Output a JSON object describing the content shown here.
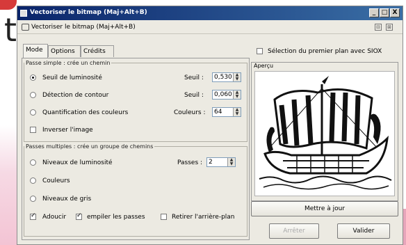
{
  "window": {
    "title": "Vectoriser le bitmap (Maj+Alt+B)",
    "controls": {
      "minimize": "_",
      "maximize": "□",
      "close": "X"
    }
  },
  "subheader": {
    "title": "Vectoriser le bitmap (Maj+Alt+B)",
    "btn1": "⊟",
    "btn2": "⊠"
  },
  "tabs": [
    {
      "label": "Mode"
    },
    {
      "label": "Options"
    },
    {
      "label": "Crédits"
    }
  ],
  "single_scan": {
    "legend": "Passe simple : crée un chemin",
    "brightness": {
      "label": "Seuil de luminosité",
      "param_label": "Seuil :",
      "value": "0,530"
    },
    "edge": {
      "label": "Détection de contour",
      "param_label": "Seuil :",
      "value": "0,060"
    },
    "quant": {
      "label": "Quantification des couleurs",
      "param_label": "Couleurs :",
      "value": "64"
    },
    "invert": {
      "label": "Inverser l'image"
    }
  },
  "multi_scan": {
    "legend": "Passes multiples : crée un groupe de chemins",
    "brightness_steps": {
      "label": "Niveaux de luminosité",
      "param_label": "Passes :",
      "value": "2"
    },
    "colors": {
      "label": "Couleurs"
    },
    "grays": {
      "label": "Niveaux de gris"
    },
    "smooth": {
      "label": "Adoucir"
    },
    "stack": {
      "label": "empiler les passes"
    },
    "remove_bg": {
      "label": "Retirer l'arrière-plan"
    }
  },
  "foreground": {
    "label": "Sélection du premier plan avec SIOX"
  },
  "preview": {
    "title": "Aperçu"
  },
  "buttons": {
    "update": "Mettre à jour",
    "stop": "Arrêter",
    "ok": "Valider"
  },
  "background_text": "t"
}
